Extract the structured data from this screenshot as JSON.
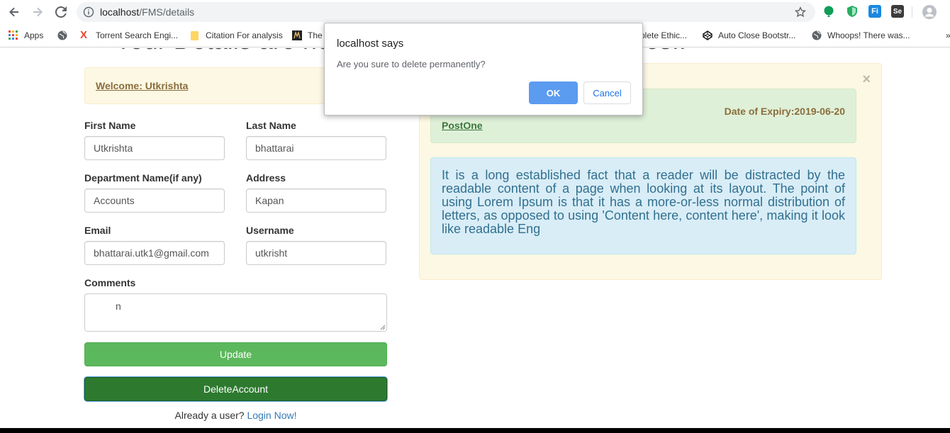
{
  "browser": {
    "url_host": "localhost",
    "url_path": "/FMS/details",
    "bookmarks": [
      {
        "label": "Apps",
        "icon": "apps-grid-icon"
      },
      {
        "label": "",
        "icon": "globe-icon"
      },
      {
        "label": "Torrent Search Engi...",
        "icon": "x-logo-icon"
      },
      {
        "label": "Citation For analysis",
        "icon": "folder-icon"
      },
      {
        "label": "The",
        "icon": "site-favicon"
      },
      {
        "label": "plete Ethic...",
        "icon": ""
      },
      {
        "label": "Auto Close Bootstr...",
        "icon": "codepen-icon"
      },
      {
        "label": "Whoops! There was...",
        "icon": "globe-icon"
      }
    ]
  },
  "page": {
    "heading": "Your Details are here",
    "heading_right": "ices..",
    "welcome": "Welcome: Utkrishta",
    "form": {
      "first_name_label": "First Name",
      "first_name_value": "Utkrishta",
      "last_name_label": "Last Name",
      "last_name_value": "bhattarai",
      "department_label": "Department Name(if any)",
      "department_value": "Accounts",
      "address_label": "Address",
      "address_value": "Kapan",
      "email_label": "Email",
      "email_value": "bhattarai.utk1@gmail.com",
      "username_label": "Username",
      "username_value": "utkrisht",
      "comments_label": "Comments",
      "comments_value": "n",
      "update_label": "Update",
      "delete_label": "DeleteAccount",
      "login_prompt": "Already a user?",
      "login_link": "Login Now!"
    },
    "post": {
      "close": "×",
      "expiry": "Date of Expiry:2019-06-20",
      "title": "PostOne",
      "body": "It is a long established fact that a reader will be distracted by the readable content of a page when looking at its layout. The point of using Lorem Ipsum is that it has a more-or-less normal distribution of letters, as opposed to using 'Content here, content here', making it look like readable Eng"
    }
  },
  "dialog": {
    "title": "localhost says",
    "message": "Are you sure to delete permanently?",
    "ok": "OK",
    "cancel": "Cancel"
  },
  "colors": {
    "primary_button": "#5cb85c",
    "delete_button": "#2d7a2f",
    "dialog_ok": "#5b9bf0",
    "link": "#337ab7"
  }
}
